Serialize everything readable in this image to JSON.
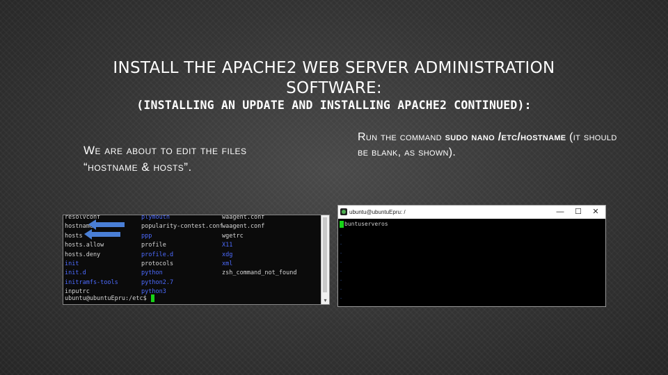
{
  "slide": {
    "title_line1": "INSTALL THE APACHE2 WEB SERVER ADMINISTRATION",
    "title_line2": "SOFTWARE:",
    "subtitle": "(INSTALLING AN UPDATE AND INSTALLING APACHE2 CONTINUED):",
    "left_line1": "We are about to edit the files",
    "left_line2": "“hostname & hosts”.",
    "right_pre": "Run the command ",
    "right_cmd": "sudo nano /etc/hostname",
    "right_post": " (it should be blank, as shown)."
  },
  "left_terminal": {
    "col1": [
      {
        "text": "resolvconf",
        "color": "white"
      },
      {
        "text": "hostname",
        "color": "white"
      },
      {
        "text": "hosts",
        "color": "white"
      },
      {
        "text": "hosts.allow",
        "color": "white"
      },
      {
        "text": "hosts.deny",
        "color": "white"
      },
      {
        "text": "init",
        "color": "blue"
      },
      {
        "text": "init.d",
        "color": "blue"
      },
      {
        "text": "initramfs-tools",
        "color": "blue"
      },
      {
        "text": "inputrc",
        "color": "white"
      }
    ],
    "col2": [
      {
        "text": "plymouth",
        "color": "blue"
      },
      {
        "text": "popularity-contest.conf",
        "color": "white"
      },
      {
        "text": "ppp",
        "color": "blue"
      },
      {
        "text": "profile",
        "color": "white"
      },
      {
        "text": "profile.d",
        "color": "blue"
      },
      {
        "text": "protocols",
        "color": "white"
      },
      {
        "text": "python",
        "color": "blue"
      },
      {
        "text": "python2.7",
        "color": "blue"
      },
      {
        "text": "python3",
        "color": "blue"
      }
    ],
    "col3": [
      {
        "text": "waagent.conf",
        "color": "white"
      },
      {
        "text": "waagent.conf",
        "color": "white"
      },
      {
        "text": "wgetrc",
        "color": "white"
      },
      {
        "text": "X11",
        "color": "blue"
      },
      {
        "text": "xdg",
        "color": "blue"
      },
      {
        "text": "xml",
        "color": "blue"
      },
      {
        "text": "zsh_command_not_found",
        "color": "white"
      },
      {
        "text": "",
        "color": "white"
      },
      {
        "text": "",
        "color": "white"
      }
    ],
    "prompt": "ubuntu@ubuntuEpru:/etc$ ",
    "scroll_down_glyph": "▾"
  },
  "right_terminal": {
    "window_title": "ubuntu@ubuntuEpru: /",
    "minimize": "—",
    "maximize": "☐",
    "close": "✕",
    "content": "buntuserveros",
    "tilde_count": 8
  },
  "colors": {
    "terminal_blue": "#4d6bff",
    "cursor_green": "#17d417",
    "arrow_blue": "#4a7fd6"
  }
}
